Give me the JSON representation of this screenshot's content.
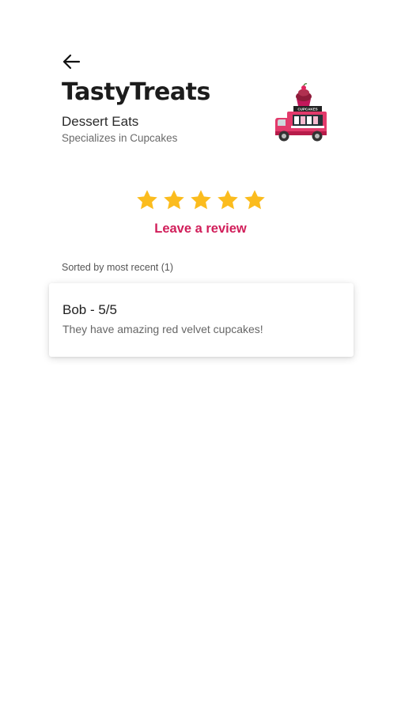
{
  "header": {
    "title": "TastyTreats",
    "subtitle": "Dessert Eats",
    "specialty": "Specializes in Cupcakes"
  },
  "truck_image": {
    "sign_text": "CUPCAKES"
  },
  "rating": {
    "value": 5,
    "max": 5,
    "color": "#FBBC1E"
  },
  "leave_review_label": "Leave a review",
  "sort_label": "Sorted by most recent (1)",
  "reviews": [
    {
      "header": "Bob - 5/5",
      "text": "They have amazing red velvet cupcakes!"
    }
  ],
  "colors": {
    "accent": "#D11E5A",
    "title": "#1C1C1C"
  }
}
